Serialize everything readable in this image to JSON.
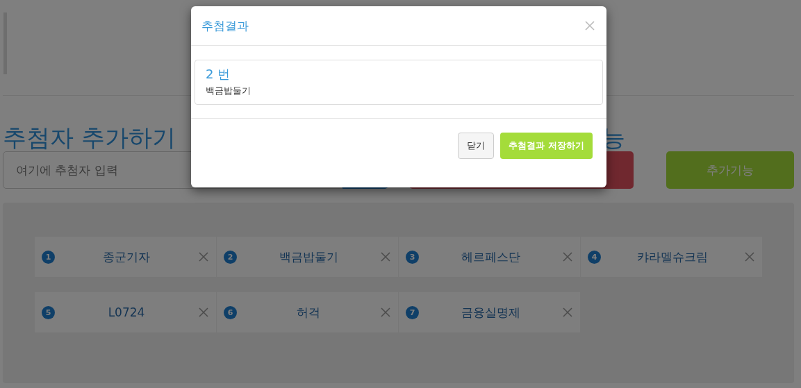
{
  "page": {
    "heading": "추첨자 추가하기",
    "second_heading": "능",
    "input": {
      "placeholder": "여기에 추첨자 입력"
    },
    "extra_button": "추가기능"
  },
  "entries": [
    {
      "number": "1",
      "name": "종군기자"
    },
    {
      "number": "2",
      "name": "백금밥둘기"
    },
    {
      "number": "3",
      "name": "헤르페스단"
    },
    {
      "number": "4",
      "name": "캬라멜슈크림"
    },
    {
      "number": "5",
      "name": "L0724"
    },
    {
      "number": "6",
      "name": "허걱"
    },
    {
      "number": "7",
      "name": "금융실명제"
    }
  ],
  "modal": {
    "title": "추첨결과",
    "result": {
      "number": "2 번",
      "name": "백금밥둘기"
    },
    "buttons": [
      {
        "label": "닫기",
        "kind": "default"
      },
      {
        "label": "추첨결과 저장하기",
        "kind": "primary"
      }
    ]
  }
}
